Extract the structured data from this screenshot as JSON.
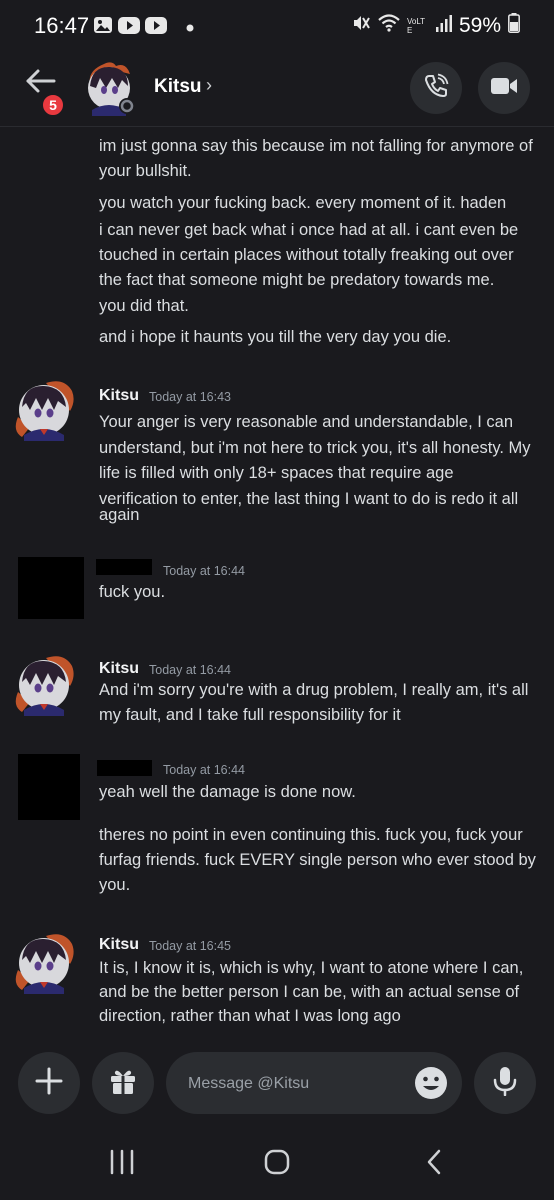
{
  "status_bar": {
    "time": "16:47",
    "battery": "59%",
    "network_label": "VoLTE",
    "icons": [
      "gallery-icon",
      "youtube-icon",
      "youtube-icon",
      "dot-icon",
      "mute-icon",
      "wifi-icon",
      "volte-icon",
      "signal-icon",
      "battery-icon"
    ]
  },
  "header": {
    "back_badge": "5",
    "name": "Kitsu",
    "chevron": "›",
    "icons": [
      "back-arrow-icon",
      "phone-icon",
      "video-camera-icon"
    ]
  },
  "messages": {
    "continued_lines": [
      "im just gonna say this because im not falling for anymore of",
      "your bullshit.",
      "you watch your fucking back. every moment of it. haden",
      "i can never get back what i once had at all. i cant even be",
      "touched in certain places without totally freaking out over",
      "the fact that someone might be predatory towards me.",
      "you did that.",
      "and i hope it haunts you till the very day you die."
    ],
    "groups": [
      {
        "author": "Kitsu",
        "time": "Today at 16:43",
        "lines": [
          "Your anger is very reasonable and understandable, I can",
          "understand, but i'm not here to trick you, it's all honesty. My",
          "life is filled with only 18+ spaces that require age",
          "verification to enter, the last thing I want to do is redo it all",
          "again"
        ]
      },
      {
        "author": "",
        "time": "Today at 16:44",
        "lines": [
          "fuck you."
        ]
      },
      {
        "author": "Kitsu",
        "time": "Today at 16:44",
        "lines": [
          "And i'm sorry you're with a drug problem, I really am, it's all",
          "my fault, and I take full responsibility for it"
        ]
      },
      {
        "author": "",
        "time": "Today at 16:44",
        "lines": [
          "yeah well the damage is done now.",
          "theres no point in even continuing this. fuck you, fuck your",
          "furfag friends. fuck EVERY single person who ever stood by",
          "you."
        ]
      },
      {
        "author": "Kitsu",
        "time": "Today at 16:45",
        "lines": [
          "It is, I know it is, which is why, I want to atone where I can,",
          "and be the better person I can be, with an actual sense of",
          "direction, rather than what I was long ago"
        ]
      }
    ]
  },
  "composer": {
    "placeholder": "Message @Kitsu",
    "icons": [
      "plus-icon",
      "gift-icon",
      "emoji-icon",
      "microphone-icon"
    ]
  },
  "nav_bar": {
    "icons": [
      "recents-icon",
      "home-icon",
      "back-icon"
    ]
  },
  "colors": {
    "background": "#1a1a1e",
    "surface": "#2b2d31",
    "text": "#dbdee1",
    "muted": "#949ba4",
    "badge": "#e8393f"
  }
}
